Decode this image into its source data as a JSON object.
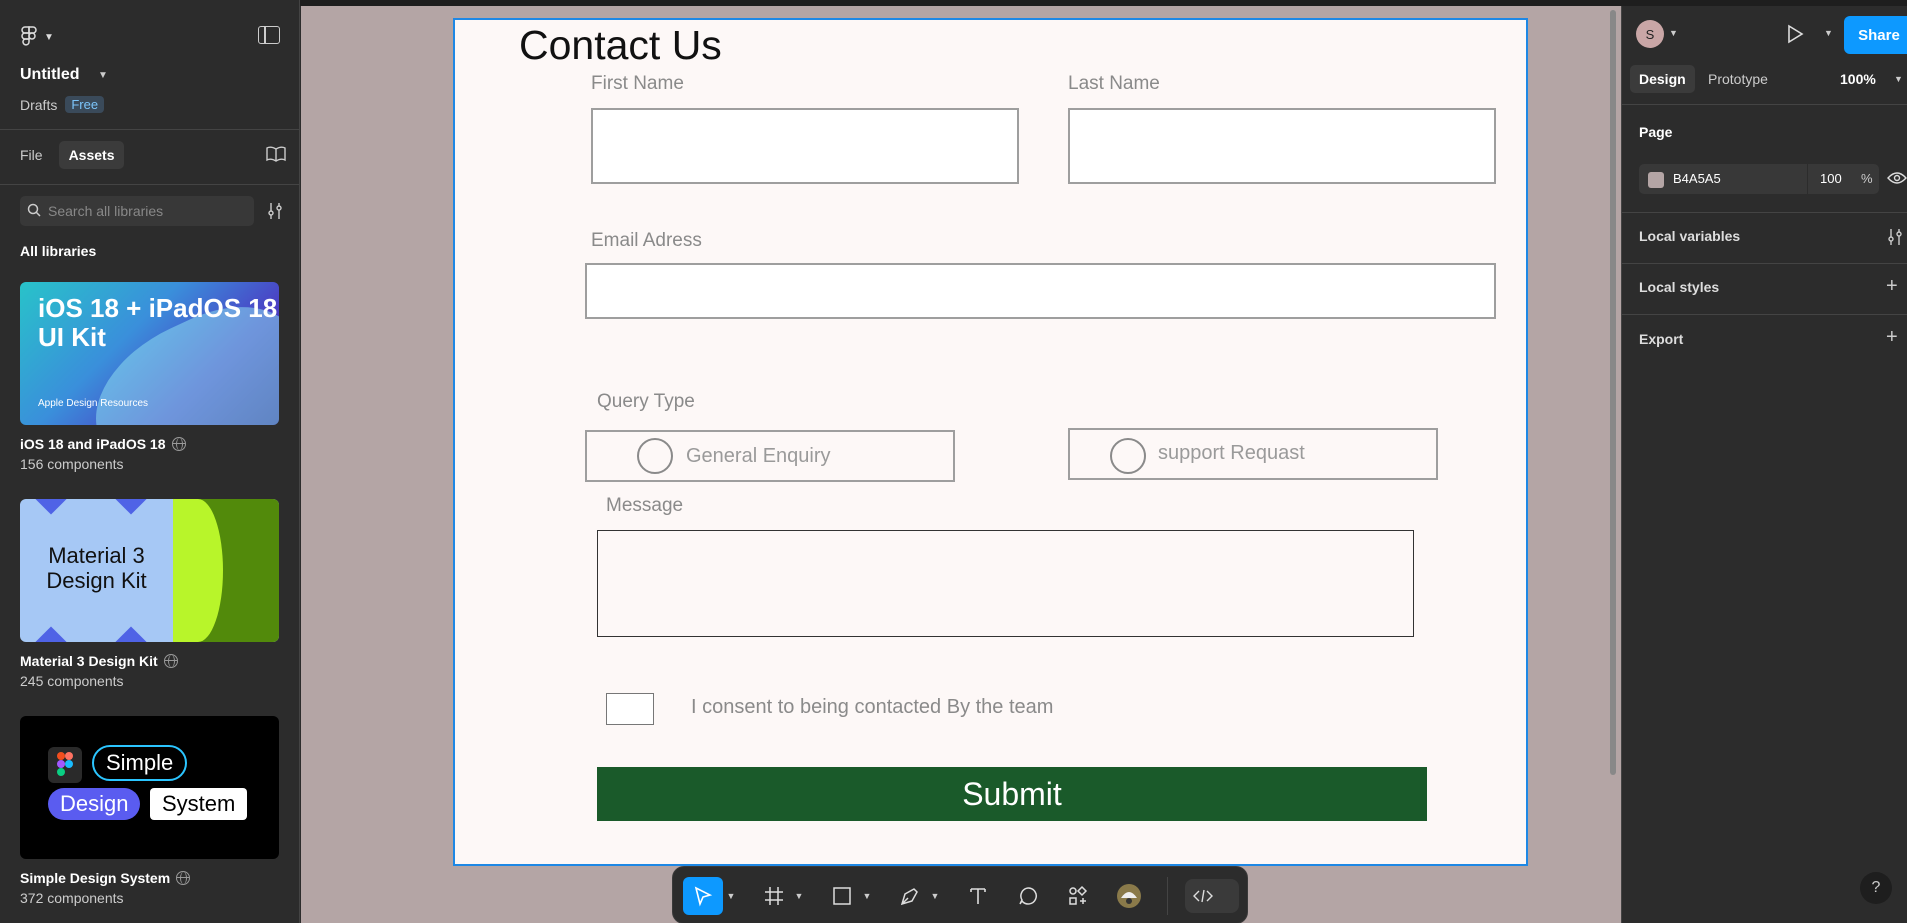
{
  "app": {
    "file_title": "Untitled",
    "location": "Drafts",
    "plan_badge": "Free"
  },
  "left_panel": {
    "tabs": [
      {
        "label": "File",
        "active": false
      },
      {
        "label": "Assets",
        "active": true
      }
    ],
    "search_placeholder": "Search all libraries",
    "section_title": "All libraries",
    "libraries": [
      {
        "name": "iOS 18 and iPadOS 18",
        "count": "156 components",
        "thumb_title_1": "iOS 18 + iPadOS 18",
        "thumb_title_2": "UI Kit",
        "thumb_sub": "Apple Design Resources"
      },
      {
        "name": "Material 3 Design Kit",
        "count": "245 components",
        "thumb_title_1": "Material 3",
        "thumb_title_2": "Design Kit"
      },
      {
        "name": "Simple Design System",
        "count": "372 components",
        "thumb_word_1": "Simple",
        "thumb_word_2": "Design",
        "thumb_word_3": "System"
      }
    ]
  },
  "canvas": {
    "background": "#b4a5a5",
    "form": {
      "title": "Contact Us",
      "first_name_label": "First Name",
      "last_name_label": "Last Name",
      "email_label": "Email Adress",
      "query_type_label": "Query Type",
      "query_options": [
        "General Enquiry",
        "support Requast"
      ],
      "message_label": "Message",
      "consent_text": "I consent to being contacted By the team",
      "submit_label": "Submit",
      "submit_color": "#1a5a2a"
    }
  },
  "toolbar": {
    "tools": [
      "move-tool",
      "frame-tool",
      "shape-tool",
      "pen-tool",
      "text-tool",
      "comment-tool",
      "actions-tool",
      "plugin-tool",
      "dev-mode-toggle"
    ]
  },
  "right_panel": {
    "avatar_initial": "S",
    "share_label": "Share",
    "tabs": [
      {
        "label": "Design",
        "active": true
      },
      {
        "label": "Prototype",
        "active": false
      }
    ],
    "zoom": "100%",
    "page_heading": "Page",
    "page_color_hex": "B4A5A5",
    "page_opacity": "100",
    "page_opacity_unit": "%",
    "sections": [
      "Local variables",
      "Local styles",
      "Export"
    ]
  },
  "help_label": "?"
}
